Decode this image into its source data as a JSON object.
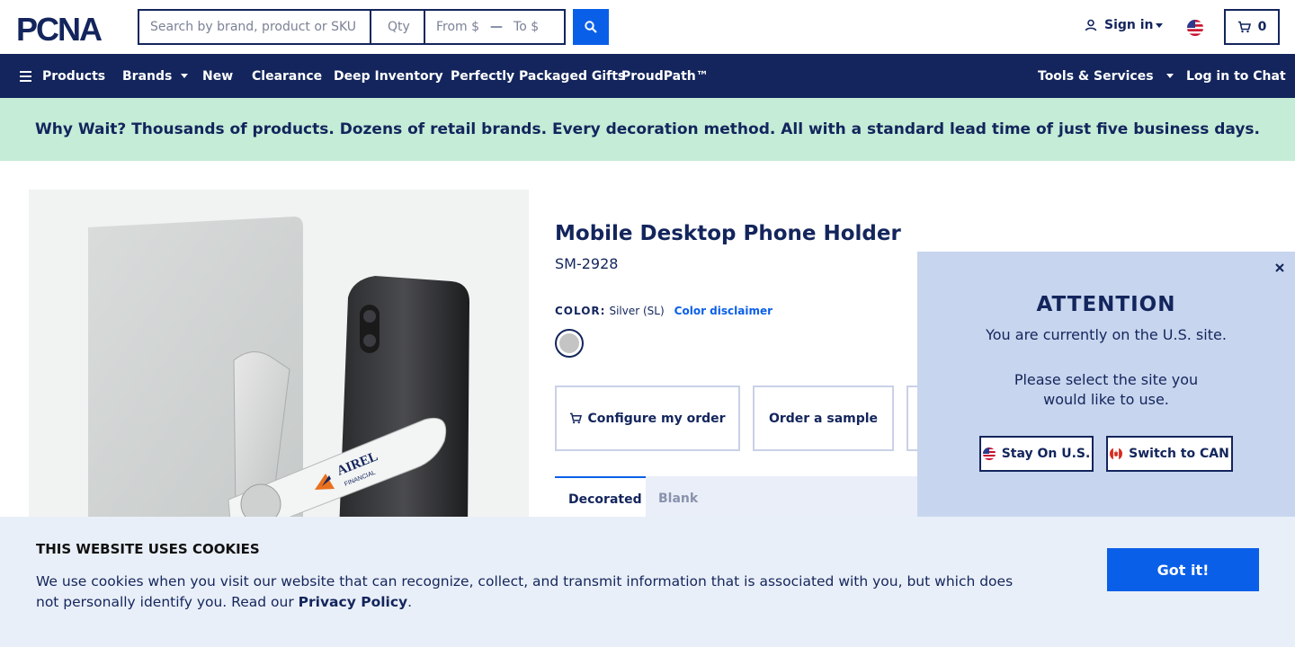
{
  "header": {
    "brand": "PCNA",
    "search_placeholder": "Search by brand, product or SKU",
    "qty_placeholder": "Qty",
    "price_from_placeholder": "From $",
    "price_to_placeholder": "To $",
    "price_separator": "—",
    "sign_in_label": "Sign in",
    "cart_count": "0"
  },
  "nav": {
    "products": "Products",
    "brands": "Brands",
    "new": "New",
    "clearance": "Clearance",
    "deep_inventory": "Deep Inventory",
    "gifts": "Perfectly Packaged Gifts",
    "proudpath": "ProudPath™",
    "tools": "Tools & Services",
    "chat": "Log in to Chat"
  },
  "banner": {
    "text": "Why Wait? Thousands of products. Dozens of retail brands. Every decoration method. All with a standard lead time of just five business days."
  },
  "product": {
    "image_brand_top": "AIREL",
    "image_brand_bottom": "FINANCIAL",
    "title": "Mobile Desktop Phone Holder",
    "sku": "SM-2928",
    "color_label": "COLOR:",
    "color_value": "Silver (SL)",
    "color_disclaimer": "Color disclaimer",
    "swatch_color": "#c4c4c4",
    "configure_label": "Configure my order",
    "sample_label": "Order a sample",
    "tabs": [
      "Decorated",
      "Blank"
    ]
  },
  "popup": {
    "title": "ATTENTION",
    "subtitle": "You are currently on the U.S. site.",
    "question": "Please select the site you would like to use.",
    "stay_label": "Stay On U.S.",
    "switch_label": "Switch to CAN"
  },
  "cookie": {
    "title": "THIS WEBSITE USES COOKIES",
    "text": "We use cookies when you visit our website that can recognize, collect, and transmit information that is associated with you, but which does not personally identify you. Read our ",
    "policy_link": "Privacy Policy",
    "text_end": ".",
    "button": "Got it!"
  },
  "colors": {
    "navy": "#13255c",
    "accent_blue": "#0a5fe8",
    "banner_green": "#c4ecd7",
    "popup_bg": "#c7d5ee",
    "cookie_bg": "#e9eff8"
  }
}
